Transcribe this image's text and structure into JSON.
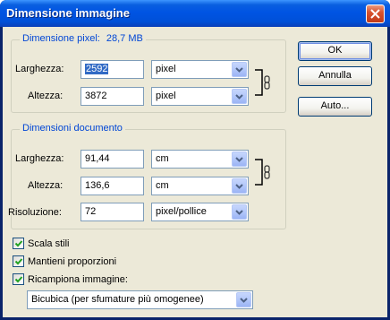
{
  "window": {
    "title": "Dimensione immagine"
  },
  "pixel_group": {
    "title": "Dimensione pixel:",
    "size": "28,7 MB",
    "width_label": "Larghezza:",
    "width_value": "2592",
    "width_unit": "pixel",
    "height_label": "Altezza:",
    "height_value": "3872",
    "height_unit": "pixel"
  },
  "document_group": {
    "title": "Dimensioni documento",
    "width_label": "Larghezza:",
    "width_value": "91,44",
    "width_unit": "cm",
    "height_label": "Altezza:",
    "height_value": "136,6",
    "height_unit": "cm",
    "resolution_label": "Risoluzione:",
    "resolution_value": "72",
    "resolution_unit": "pixel/pollice"
  },
  "buttons": {
    "ok": "OK",
    "cancel": "Annulla",
    "auto": "Auto..."
  },
  "options": {
    "scale_styles": {
      "label": "Scala stili",
      "checked": true
    },
    "constrain": {
      "label": "Mantieni proporzioni",
      "checked": true
    },
    "resample": {
      "label": "Ricampiona immagine:",
      "checked": true
    },
    "resample_method": "Bicubica (per sfumature più omogenee)"
  },
  "icons": {
    "close": "close-icon",
    "chain": "link-chain-icon",
    "dropdown": "chevron-down-icon",
    "check": "checkmark-icon"
  },
  "colors": {
    "title_bar": "#0054e3",
    "group_title": "#0046d5",
    "dialog_bg": "#ece9d8",
    "selection": "#316ac5"
  }
}
